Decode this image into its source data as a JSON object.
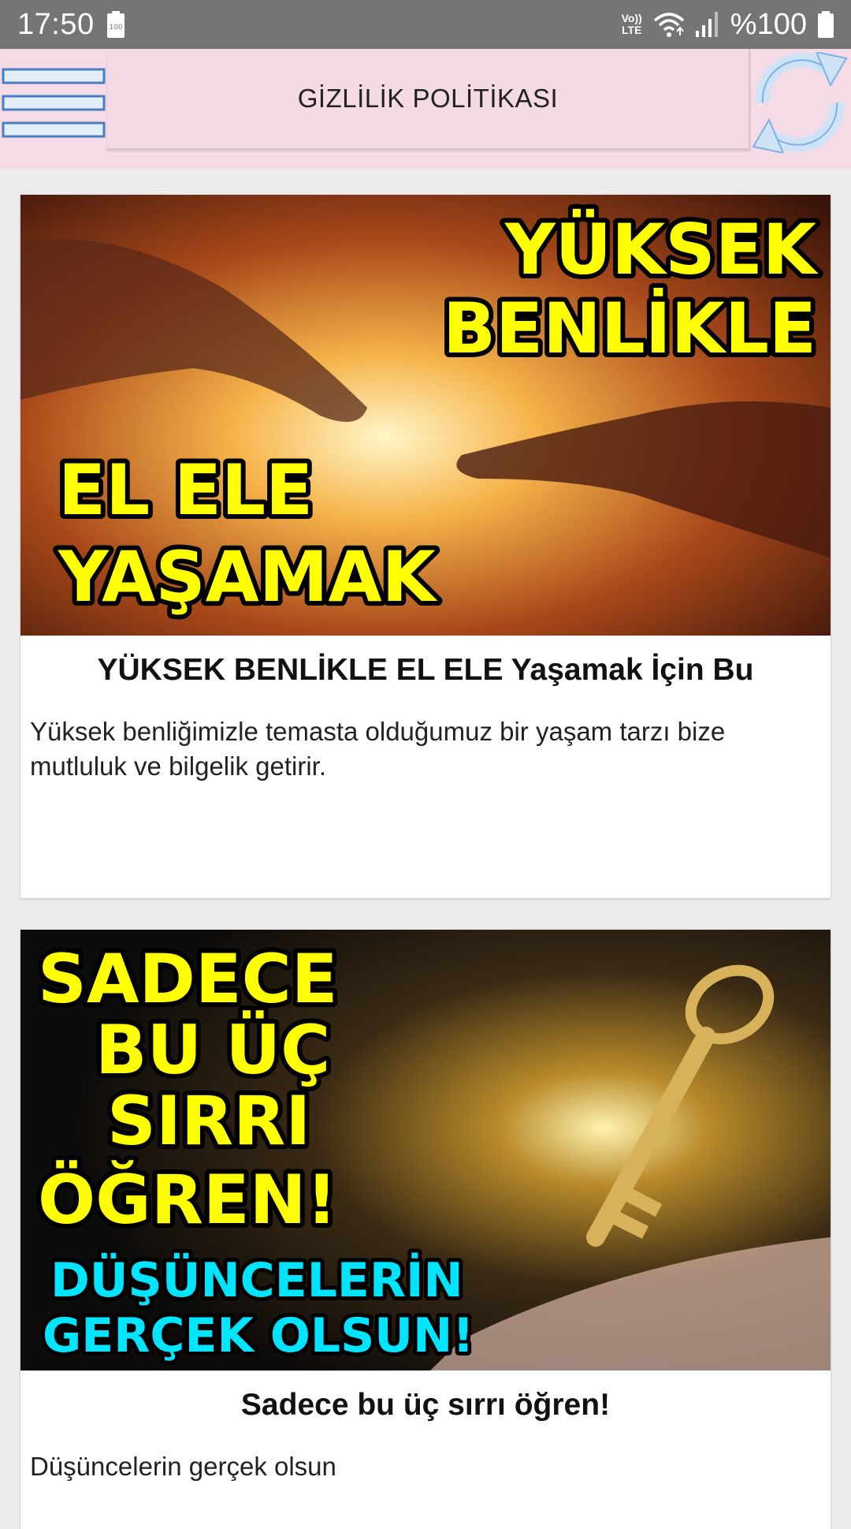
{
  "status_bar": {
    "time": "17:50",
    "battery_icon_level": "100",
    "network_label_top": "Vo))",
    "network_label_bottom": "LTE",
    "battery_percent": "%100"
  },
  "app_bar": {
    "title": "GİZLİLİK POLİTİKASI",
    "menu_icon": "hamburger-menu-icon",
    "refresh_icon": "refresh-icon"
  },
  "colors": {
    "app_bar_bg": "#f5dbe6",
    "status_bar_bg": "#757575",
    "page_bg": "#ececec",
    "thumbnail_text_yellow": "#ffff00",
    "thumbnail_text_cyan": "#00e5ff"
  },
  "cards": [
    {
      "thumbnail_lines": [
        "YÜKSEK",
        "BENLİKLE",
        "EL ELE",
        "YAŞAMAK"
      ],
      "title": "YÜKSEK BENLİKLE EL ELE Yaşamak İçin Bu",
      "description": "Yüksek benliğimizle temasta olduğumuz bir yaşam tarzı bize mutluluk ve bilgelik getirir."
    },
    {
      "thumbnail_lines": [
        "SADECE",
        "BU ÜÇ",
        "SIRRI",
        "ÖĞREN!",
        "DÜŞÜNCELERİN",
        "GERÇEK OLSUN!"
      ],
      "title": "Sadece bu üç sırrı öğren!",
      "description": "Düşüncelerin gerçek olsun"
    }
  ]
}
